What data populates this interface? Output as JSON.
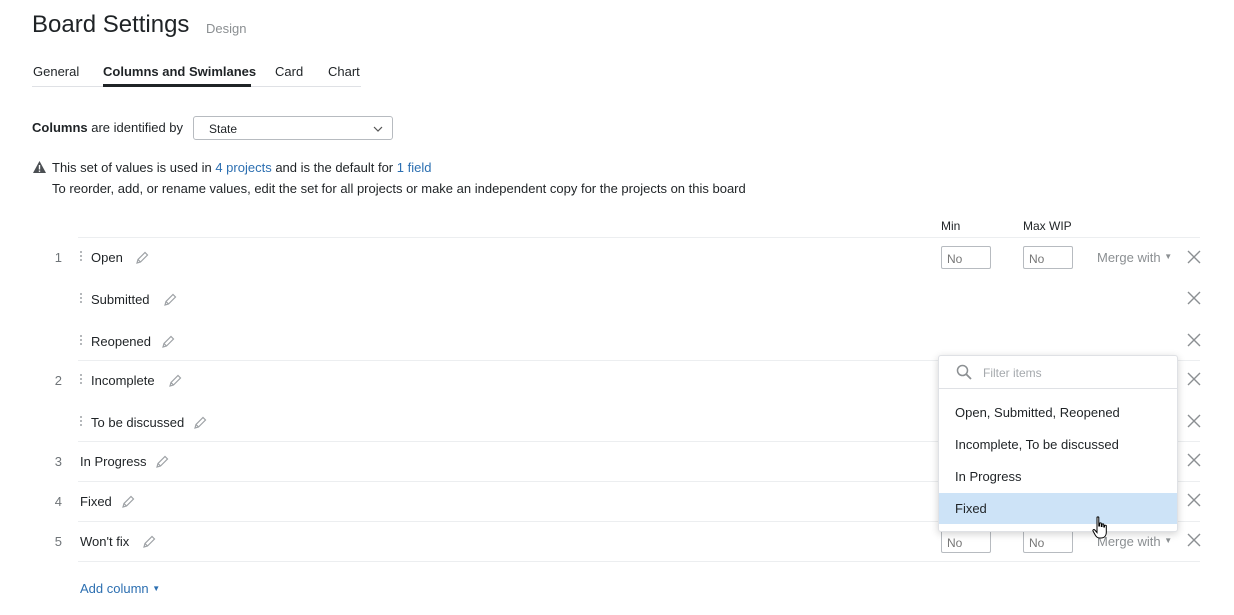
{
  "header": {
    "title": "Board Settings",
    "subtitle": "Design"
  },
  "tabs": [
    {
      "label": "General",
      "active": false
    },
    {
      "label": "Columns and Swimlanes",
      "active": true
    },
    {
      "label": "Card",
      "active": false
    },
    {
      "label": "Chart",
      "active": false
    }
  ],
  "identified_by": {
    "label_bold": "Columns",
    "label_rest": "are identified by",
    "value": "State"
  },
  "notice": {
    "part1": "This set of values is used in",
    "projects_link": "4 projects",
    "part2": "and is the default for",
    "field_link": "1 field",
    "line2": "To reorder, add, or rename values, edit the set for all projects or make an independent copy for the projects on this board"
  },
  "table_headers": {
    "min": "Min",
    "max_wip": "Max WIP"
  },
  "rows": [
    {
      "number": "1",
      "label": "Open",
      "min": "No",
      "max": "No",
      "merge": "Merge with"
    },
    {
      "number": "",
      "label": "Submitted"
    },
    {
      "number": "",
      "label": "Reopened"
    },
    {
      "number": "2",
      "label": "Incomplete"
    },
    {
      "number": "",
      "label": "To be discussed"
    },
    {
      "number": "3",
      "label": "In Progress"
    },
    {
      "number": "4",
      "label": "Fixed"
    },
    {
      "number": "5",
      "label": "Won't fix",
      "min": "No",
      "max": "No",
      "merge": "Merge with"
    }
  ],
  "add_column": "Add column",
  "merge_dropdown": {
    "placeholder": "Filter items",
    "items": [
      "Open, Submitted, Reopened",
      "Incomplete, To be discussed",
      "In Progress",
      "Fixed"
    ],
    "hovered": "Fixed"
  },
  "colors": {
    "link": "#2c6fb1",
    "hover_bg": "#cde3f7",
    "text": "#1f2326",
    "muted": "#8b8f92"
  },
  "icons": [
    "warning-icon",
    "chevron-down-icon",
    "drag-handle-icon",
    "pencil-icon",
    "close-icon",
    "search-icon",
    "hand-cursor-icon"
  ]
}
